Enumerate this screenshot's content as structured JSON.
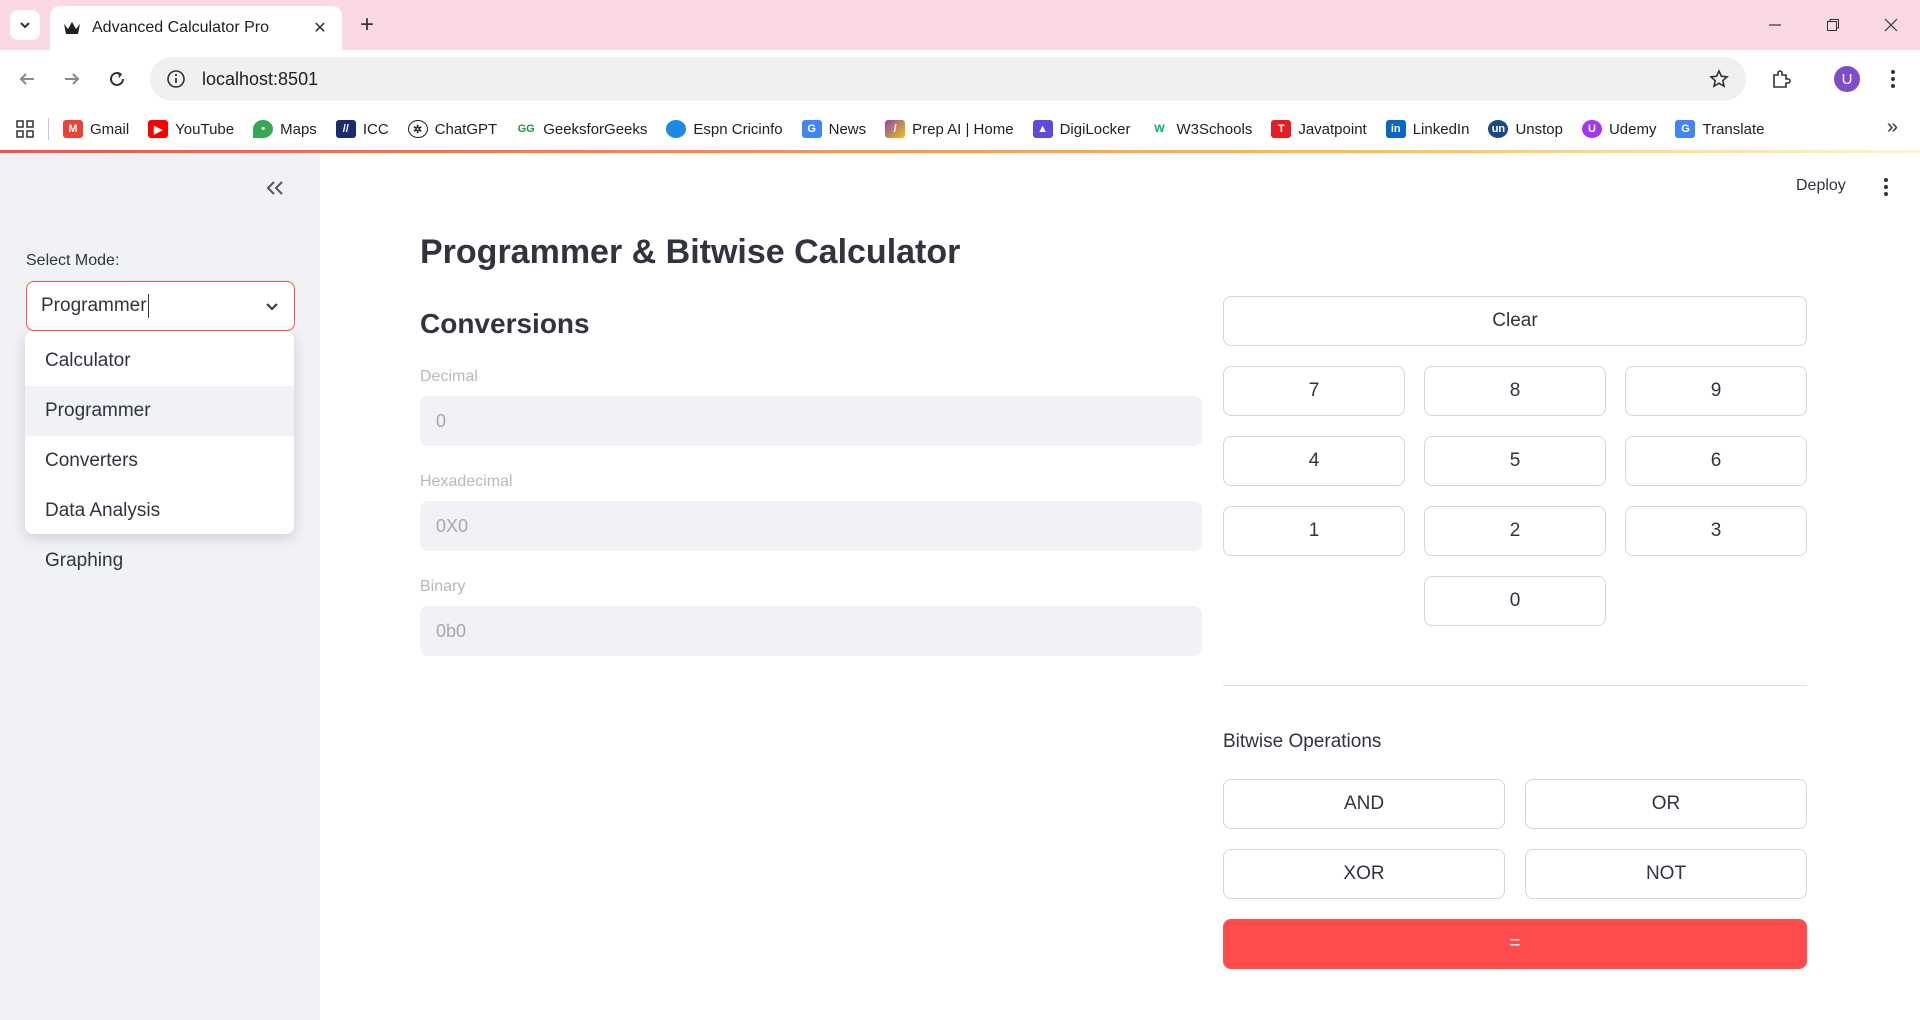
{
  "browser": {
    "tab_title": "Advanced Calculator Pro",
    "url": "localhost:8501",
    "avatar_letter": "U",
    "bookmarks": [
      {
        "label": "Gmail",
        "icon": "gmail-icon",
        "color": "#ea4335"
      },
      {
        "label": "YouTube",
        "icon": "youtube-icon",
        "color": "#ff0000"
      },
      {
        "label": "Maps",
        "icon": "maps-icon",
        "color": "#34a853"
      },
      {
        "label": "ICC",
        "icon": "icc-icon",
        "color": "#1a2a6c"
      },
      {
        "label": "ChatGPT",
        "icon": "chatgpt-icon",
        "color": "#222222"
      },
      {
        "label": "GeeksforGeeks",
        "icon": "geeksforgeeks-icon",
        "color": "#2f8d46"
      },
      {
        "label": "Espn Cricinfo",
        "icon": "espn-cricinfo-icon",
        "color": "#1e88e5"
      },
      {
        "label": "News",
        "icon": "news-icon",
        "color": "#4285f4"
      },
      {
        "label": "Prep AI | Home",
        "icon": "prep-ai-icon",
        "color": "#8e44ad"
      },
      {
        "label": "DigiLocker",
        "icon": "digilocker-icon",
        "color": "#5c4bd8"
      },
      {
        "label": "W3Schools",
        "icon": "w3schools-icon",
        "color": "#04aa6d"
      },
      {
        "label": "Javatpoint",
        "icon": "javatpoint-icon",
        "color": "#e31e24"
      },
      {
        "label": "LinkedIn",
        "icon": "linkedin-icon",
        "color": "#0a66c2"
      },
      {
        "label": "Unstop",
        "icon": "unstop-icon",
        "color": "#1c4980"
      },
      {
        "label": "Udemy",
        "icon": "udemy-icon",
        "color": "#a435f0"
      },
      {
        "label": "Translate",
        "icon": "translate-icon",
        "color": "#4285f4"
      }
    ]
  },
  "sidebar": {
    "select_label": "Select Mode:",
    "selected": "Programmer",
    "options": [
      "Calculator",
      "Programmer",
      "Converters",
      "Data Analysis",
      "Graphing"
    ]
  },
  "header": {
    "deploy_label": "Deploy"
  },
  "main": {
    "title": "Programmer & Bitwise Calculator",
    "conversions_title": "Conversions",
    "fields": [
      {
        "label": "Decimal",
        "value": "0"
      },
      {
        "label": "Hexadecimal",
        "value": "0X0"
      },
      {
        "label": "Binary",
        "value": "0b0"
      }
    ]
  },
  "keypad": {
    "clear": "Clear",
    "digits": [
      "7",
      "8",
      "9",
      "4",
      "5",
      "6",
      "1",
      "2",
      "3",
      "0"
    ]
  },
  "bitwise": {
    "title": "Bitwise Operations",
    "ops": [
      "AND",
      "OR",
      "XOR",
      "NOT"
    ],
    "equals": "="
  },
  "colors": {
    "accent": "#ff4b4b",
    "sidebar_bg": "#f0f2f6",
    "tabstrip_bg": "#fbd9e4"
  }
}
